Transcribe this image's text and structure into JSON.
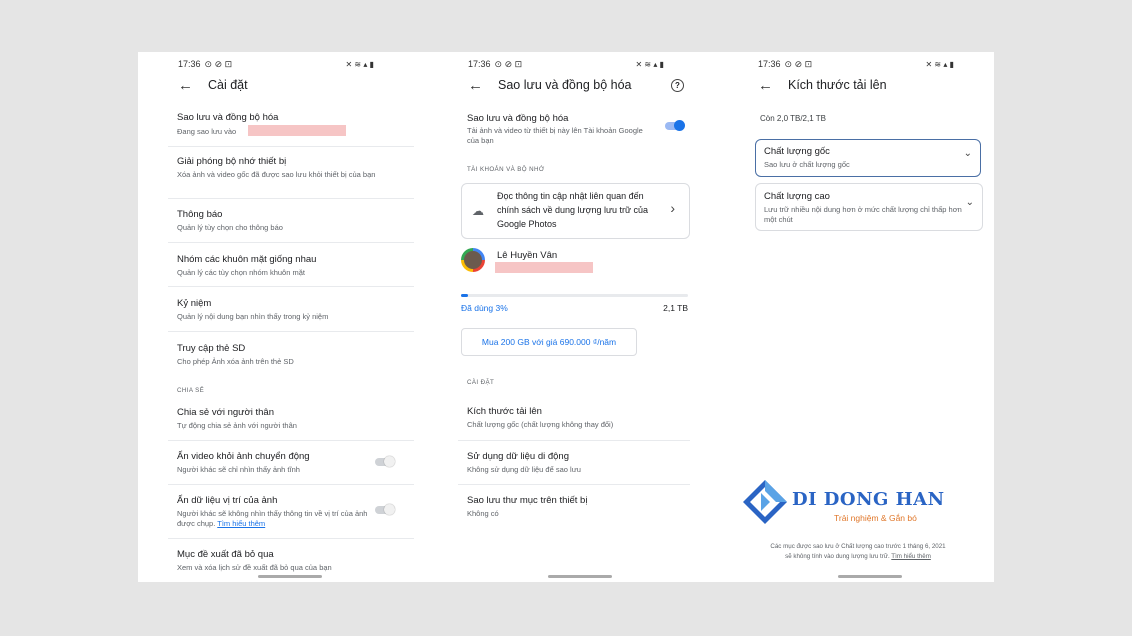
{
  "phone1": {
    "time": "17:36",
    "title": "Cài đặt",
    "items": [
      {
        "title": "Sao lưu và đồng bộ hóa",
        "subtitle": "Đang sao lưu vào"
      },
      {
        "title": "Giải phóng bộ nhớ thiết bị",
        "subtitle": "Xóa ảnh và video gốc đã được sao lưu khỏi thiết bị của bạn"
      },
      {
        "title": "Thông báo",
        "subtitle": "Quản lý tùy chọn cho thông báo"
      },
      {
        "title": "Nhóm các khuôn mặt giống nhau",
        "subtitle": "Quản lý các tùy chọn nhóm khuôn mặt"
      },
      {
        "title": "Kỷ niệm",
        "subtitle": "Quản lý nội dung bạn nhìn thấy trong kỷ niệm"
      },
      {
        "title": "Truy cập thẻ SD",
        "subtitle": "Cho phép Ảnh xóa ảnh trên thẻ SD"
      }
    ],
    "section_share": "CHIA SẺ",
    "share_items": [
      {
        "title": "Chia sẻ với người thân",
        "subtitle": "Tự động chia sẻ ảnh với người thân"
      },
      {
        "title": "Ẩn video khỏi ảnh chuyển động",
        "subtitle": "Người khác sẽ chỉ nhìn thấy ảnh tĩnh",
        "toggle": false
      },
      {
        "title": "Ẩn dữ liệu vị trí của ảnh",
        "subtitle": "Người khác sẽ không nhìn thấy thông tin về vị trí của ảnh được chụp.",
        "link": "Tìm hiểu thêm",
        "toggle": false
      },
      {
        "title": "Mục đề xuất đã bỏ qua",
        "subtitle": "Xem và xóa lịch sử đề xuất đã bỏ qua của bạn"
      }
    ]
  },
  "phone2": {
    "time": "17:36",
    "title": "Sao lưu và đồng bộ hóa",
    "backup_title": "Sao lưu và đồng bộ hóa",
    "backup_sub": "Tải ảnh và video từ thiết bị này lên Tài khoản Google của bạn",
    "backup_on": true,
    "section_account": "TÀI KHOẢN VÀ BỘ NHỚ",
    "policy_card": "Đọc thông tin cập nhật liên quan đến chính sách về dung lượng lưu trữ của Google Photos",
    "account_name": "Lê Huyền Vân",
    "storage_used_label": "Đã dùng 3%",
    "storage_used_fraction": 0.03,
    "storage_total": "2,1 TB",
    "buy_button": "Mua 200 GB với giá 690.000 ₫/năm",
    "section_settings": "CÀI ĐẶT",
    "settings": [
      {
        "title": "Kích thước tải lên",
        "subtitle": "Chất lượng gốc (chất lượng không thay đổi)"
      },
      {
        "title": "Sử dụng dữ liệu di động",
        "subtitle": "Không sử dụng dữ liệu để sao lưu"
      },
      {
        "title": "Sao lưu thư mục trên thiết bị",
        "subtitle": "Không có"
      }
    ]
  },
  "phone3": {
    "time": "17:36",
    "title": "Kích thước tải lên",
    "remaining": "Còn 2,0 TB/2,1 TB",
    "options": [
      {
        "title": "Chất lượng gốc",
        "subtitle": "Sao lưu ở chất lượng gốc",
        "selected": true
      },
      {
        "title": "Chất lượng cao",
        "subtitle": "Lưu trữ nhiều nội dung hơn ở mức chất lượng chỉ thấp hơn một chút",
        "selected": false
      }
    ],
    "footer": "Các mục được sao lưu ở Chất lượng cao trước 1 tháng 6, 2021 sẽ không tính vào dung lượng lưu trữ.",
    "footer_link": "Tìm hiểu thêm"
  },
  "watermark": {
    "brand": "DI DONG HAN",
    "tagline": "Trải nghiệm & Gắn bó"
  },
  "colors": {
    "accent": "#1a73e8",
    "brand": "#2a64c4",
    "tagline": "#e0772a",
    "redacted": "#f6c5c5"
  }
}
